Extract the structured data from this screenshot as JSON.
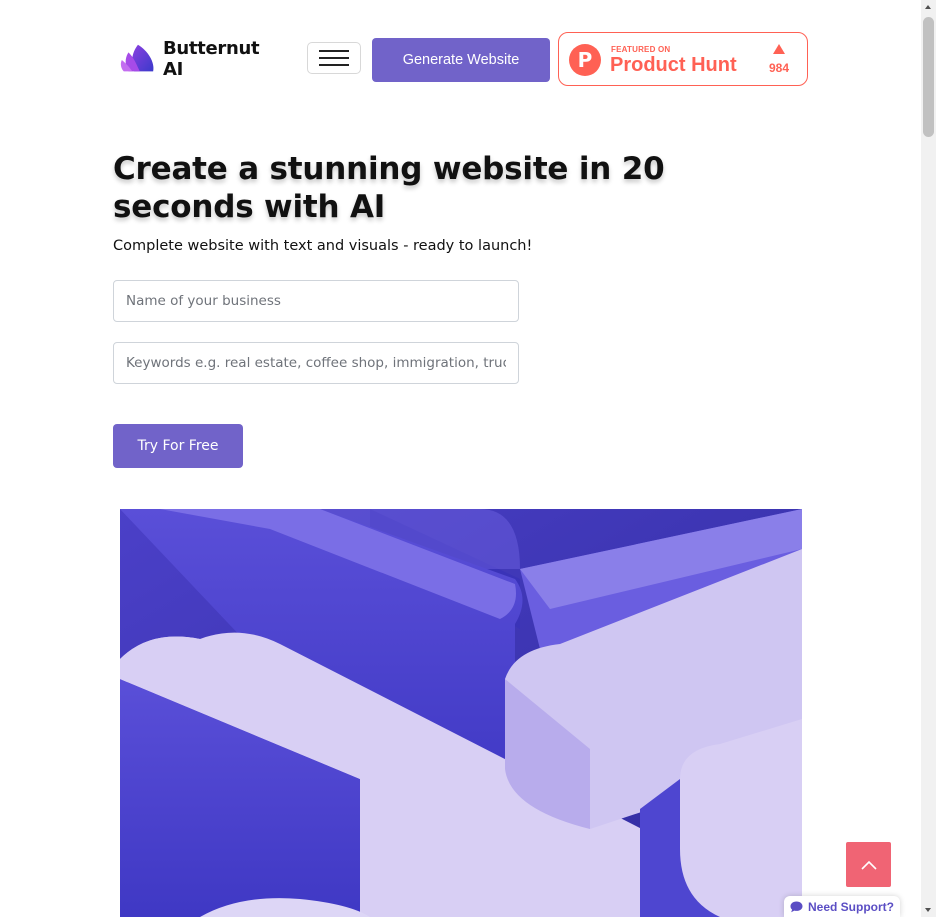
{
  "header": {
    "logo_text": "Butternut AI",
    "menu_icon": "hamburger-icon",
    "generate_label": "Generate Website",
    "product_hunt": {
      "logo_letter": "P",
      "featured_label": "FEATURED ON",
      "name": "Product Hunt",
      "upvotes": "984",
      "brand_color": "#ff6154"
    }
  },
  "hero": {
    "title": "Create a stunning website in 20 seconds with AI",
    "subtitle": "Complete website with text and visuals - ready to launch!",
    "business_name_placeholder": "Name of your business",
    "keywords_placeholder": "Keywords e.g. real estate, coffee shop, immigration, truck",
    "cta_label": "Try For Free",
    "image": "abstract-purple-3d-shapes"
  },
  "floating": {
    "scroll_top_icon": "chevron-up-icon",
    "support_label": "Need Support?",
    "support_icon": "chat-bubble-icon"
  },
  "colors": {
    "accent": "#7163c9",
    "scroll_top": "#f06474",
    "support_text": "#5b4ec4"
  }
}
